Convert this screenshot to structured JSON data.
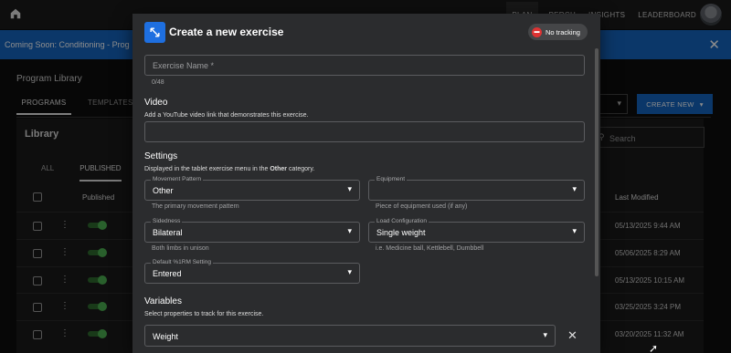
{
  "nav": {
    "links": [
      "PLAN",
      "PERCH",
      "INSIGHTS",
      "LEADERBOARD"
    ]
  },
  "banner": {
    "text": "Coming Soon: Conditioning - Prog",
    "close_icon": "close-icon"
  },
  "library_page": {
    "title": "Program Library",
    "tabs": [
      "PROGRAMS",
      "TEMPLATES"
    ],
    "create_button": "CREATE NEW",
    "search_placeholder": "Search",
    "card_title": "Library",
    "subtabs": [
      "ALL",
      "PUBLISHED"
    ],
    "columns": {
      "published": "Published",
      "last_modified": "Last Modified"
    },
    "rows": [
      {
        "date": "05/13/2025 9:44 AM"
      },
      {
        "date": "05/06/2025 8:29 AM"
      },
      {
        "date": "05/13/2025 10:15 AM"
      },
      {
        "date": "03/25/2025 3:24 PM"
      },
      {
        "date": "03/20/2025 11:32 AM"
      }
    ]
  },
  "modal": {
    "title": "Create a new exercise",
    "tracking_chip": "No tracking",
    "exercise_name": {
      "placeholder": "Exercise Name *",
      "counter": "0/48"
    },
    "video": {
      "title": "Video",
      "description": "Add a YouTube video link that demonstrates this exercise."
    },
    "settings": {
      "title": "Settings",
      "desc_prefix": "Displayed in the tablet exercise menu in the ",
      "desc_bold": "Other",
      "desc_suffix": " category.",
      "movement_pattern": {
        "label": "Movement Pattern",
        "value": "Other",
        "helper": "The primary movement pattern"
      },
      "equipment": {
        "label": "Equipment",
        "value": "",
        "helper": "Piece of equipment used (if any)"
      },
      "sidedness": {
        "label": "Sidedness",
        "value": "Bilateral",
        "helper": "Both limbs in unison"
      },
      "load_configuration": {
        "label": "Load Configuration",
        "value": "Single weight",
        "helper": "i.e. Medicine ball, Kettlebell, Dumbbell"
      },
      "default_1rm": {
        "label": "Default %1RM Setting",
        "value": "Entered"
      }
    },
    "variables": {
      "title": "Variables",
      "description": "Select properties to track for this exercise.",
      "first_variable": "Weight"
    }
  },
  "colors": {
    "accent": "#1565c0",
    "modal_bg": "#2b2c2e",
    "toggle_on": "#4caf50"
  }
}
